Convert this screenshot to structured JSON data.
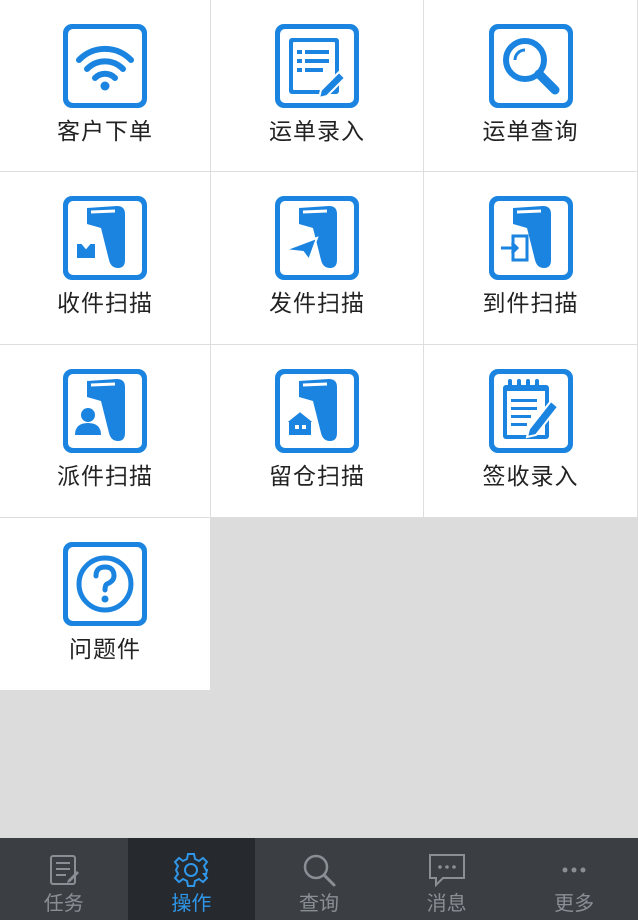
{
  "tiles": [
    {
      "label": "客户下单",
      "icon": "wifi-icon"
    },
    {
      "label": "运单录入",
      "icon": "form-edit-icon"
    },
    {
      "label": "运单查询",
      "icon": "magnifier-icon"
    },
    {
      "label": "收件扫描",
      "icon": "scanner-receive-icon"
    },
    {
      "label": "发件扫描",
      "icon": "scanner-send-icon"
    },
    {
      "label": "到件扫描",
      "icon": "scanner-arrive-icon"
    },
    {
      "label": "派件扫描",
      "icon": "scanner-deliver-icon"
    },
    {
      "label": "留仓扫描",
      "icon": "scanner-warehouse-icon"
    },
    {
      "label": "签收录入",
      "icon": "notepad-sign-icon"
    },
    {
      "label": "问题件",
      "icon": "question-icon"
    }
  ],
  "tabbar": {
    "items": [
      {
        "label": "任务",
        "icon": "task-list-icon",
        "active": false
      },
      {
        "label": "操作",
        "icon": "gear-icon",
        "active": true
      },
      {
        "label": "查询",
        "icon": "search-icon",
        "active": false
      },
      {
        "label": "消息",
        "icon": "message-icon",
        "active": false
      },
      {
        "label": "更多",
        "icon": "more-icon",
        "active": false
      }
    ]
  },
  "colors": {
    "accent": "#1a84e0",
    "tabbar_bg": "#3b3f44",
    "tab_active_bg": "#26292d",
    "tab_active_text": "#2f96e8",
    "tab_text": "#8a8f95",
    "page_bg": "#dcdcdc"
  }
}
